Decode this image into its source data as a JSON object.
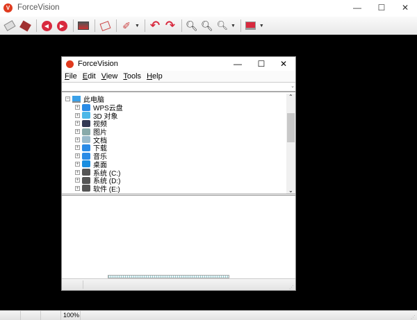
{
  "app": {
    "title": "ForceVision",
    "logo_letter": "V"
  },
  "window_controls": {
    "minimize": "—",
    "maximize": "☐",
    "close": "✕"
  },
  "toolbar": {
    "items": [
      "open-icon",
      "save-icon",
      "previous-icon",
      "next-icon",
      "image-icon",
      "slideshow-icon",
      "edit-icon",
      "undo-icon",
      "redo-icon",
      "zoom-in-icon",
      "zoom-out-icon",
      "zoom-icon",
      "monitor-icon"
    ]
  },
  "status": {
    "zoom": "100%"
  },
  "inner": {
    "title": "ForceVision",
    "menu": [
      "File",
      "Edit",
      "View",
      "Tools",
      "Help"
    ],
    "tree": {
      "root": "此电脑",
      "items": [
        {
          "label": "WPS云盘",
          "icon": "cloud-icon",
          "color": "#2a8be6"
        },
        {
          "label": "3D 对象",
          "icon": "cube-icon",
          "color": "#4cb8e8"
        },
        {
          "label": "视频",
          "icon": "video-icon",
          "color": "#333a55"
        },
        {
          "label": "图片",
          "icon": "picture-icon",
          "color": "#8aa"
        },
        {
          "label": "文档",
          "icon": "document-icon",
          "color": "#9bc"
        },
        {
          "label": "下载",
          "icon": "download-icon",
          "color": "#2a8be6"
        },
        {
          "label": "音乐",
          "icon": "music-icon",
          "color": "#2a8be6"
        },
        {
          "label": "桌面",
          "icon": "desktop-icon",
          "color": "#1a8ee0"
        },
        {
          "label": "系统 (C:)",
          "icon": "drive-icon",
          "color": "#555"
        },
        {
          "label": "系统 (D:)",
          "icon": "drive-icon",
          "color": "#555"
        },
        {
          "label": "软件 (E:)",
          "icon": "drive-icon",
          "color": "#555"
        }
      ]
    }
  }
}
